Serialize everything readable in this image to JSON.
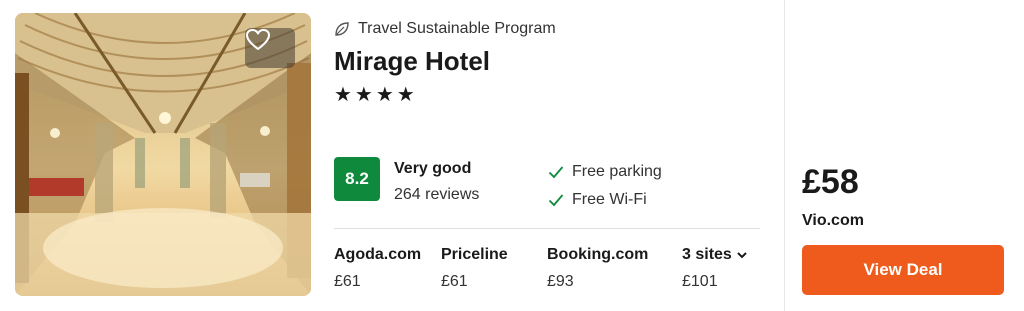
{
  "hotel": {
    "program_label": "Travel Sustainable Program",
    "name": "Mirage Hotel",
    "stars_text": "★★★★",
    "star_count": 4,
    "score": "8.2",
    "rating_label": "Very good",
    "review_count": "264 reviews",
    "amenities": [
      "Free parking",
      "Free Wi-Fi"
    ]
  },
  "sites": [
    {
      "name": "Agoda.com",
      "price": "£61"
    },
    {
      "name": "Priceline",
      "price": "£61"
    },
    {
      "name": "Booking.com",
      "price": "£93"
    },
    {
      "name": "3 sites",
      "price": "£101"
    }
  ],
  "deal": {
    "price": "£58",
    "provider": "Vio.com",
    "button_label": "View Deal"
  },
  "colors": {
    "score_badge": "#0f8a3c",
    "deal_button": "#ee5b1c",
    "check": "#0f8a3c"
  },
  "icons": {
    "program": "leaf-icon",
    "favorite": "heart-icon",
    "amenity": "check-icon",
    "more": "chevron-down-icon"
  }
}
